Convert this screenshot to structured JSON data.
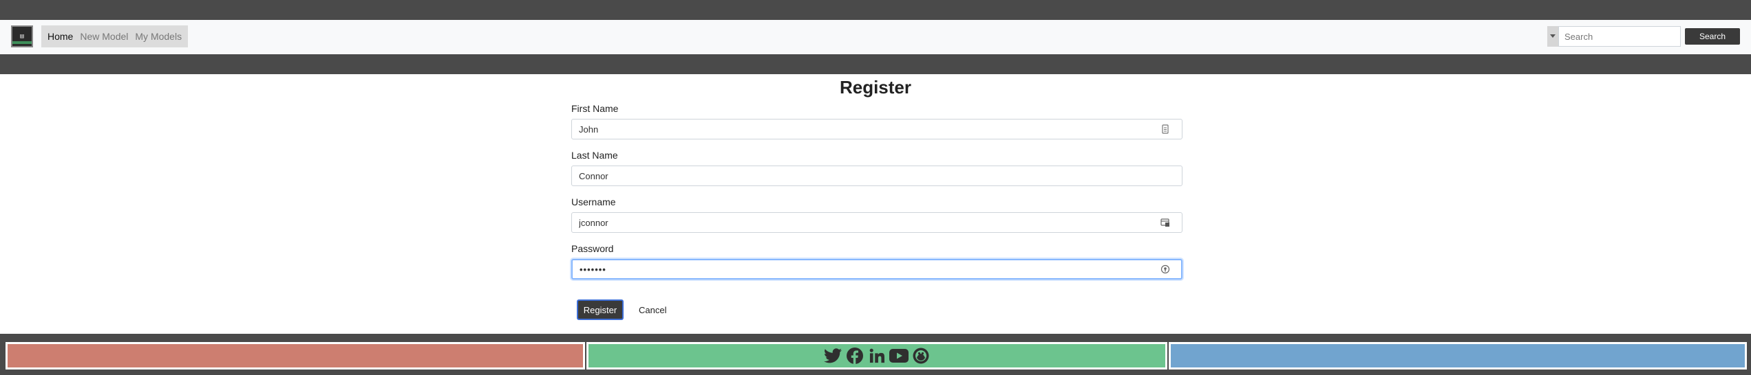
{
  "nav": {
    "logo_alt": "logo",
    "links": [
      {
        "label": "Home",
        "active": true
      },
      {
        "label": "New Model",
        "active": false
      },
      {
        "label": "My Models",
        "active": false
      }
    ],
    "search": {
      "placeholder": "Search",
      "value": "",
      "button_label": "Search"
    }
  },
  "page": {
    "title": "Register"
  },
  "form": {
    "first_name": {
      "label": "First Name",
      "value": "John"
    },
    "last_name": {
      "label": "Last Name",
      "value": "Connor"
    },
    "username": {
      "label": "Username",
      "value": "jconnor"
    },
    "password": {
      "label": "Password",
      "value": "•••••••"
    }
  },
  "actions": {
    "register_label": "Register",
    "cancel_label": "Cancel"
  },
  "footer": {
    "social_icons": [
      "twitter-icon",
      "facebook-icon",
      "linkedin-icon",
      "youtube-icon",
      "github-icon"
    ],
    "colors": {
      "left": "#cd7e70",
      "center": "#6cc48e",
      "right": "#71a4cf"
    }
  },
  "colors": {
    "band": "#4a4a4a",
    "navbar": "#f8f9fa",
    "button": "#3a3a3a",
    "focus": "#86b7fe"
  }
}
